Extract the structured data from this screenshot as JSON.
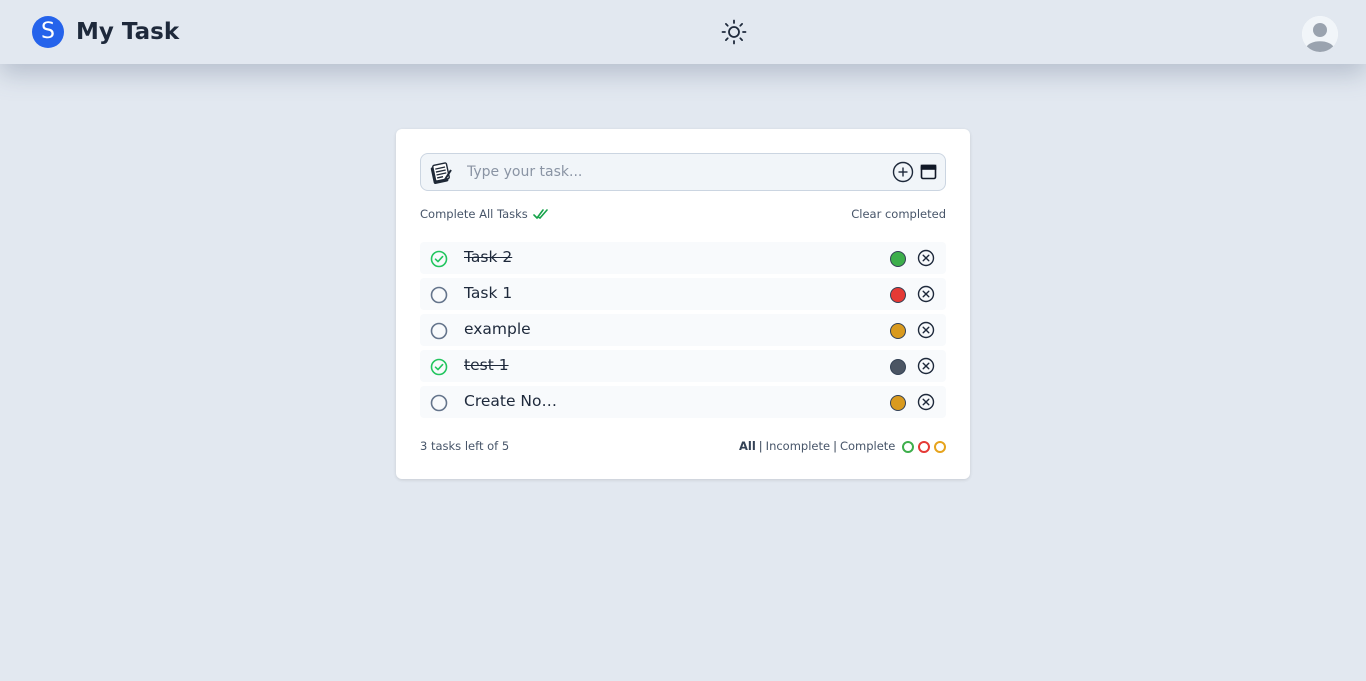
{
  "header": {
    "logo_letter": "S",
    "title": "My Task",
    "theme_icon": "sun-icon",
    "avatar_icon": "user-avatar-icon"
  },
  "input": {
    "placeholder": "Type your task...",
    "value": "",
    "icons": [
      "notepad-icon",
      "plus-circle-icon",
      "calendar-icon"
    ]
  },
  "actions": {
    "complete_all_label": "Complete All Tasks",
    "clear_completed_label": "Clear completed"
  },
  "tasks": [
    {
      "text": "Task 2",
      "completed": true,
      "priority_color": "#3dae4b"
    },
    {
      "text": "Task 1",
      "completed": false,
      "priority_color": "#e53935"
    },
    {
      "text": "example",
      "completed": false,
      "priority_color": "#d99a1e"
    },
    {
      "text": "test 1",
      "completed": true,
      "priority_color": "#4b5563"
    },
    {
      "text": "Create No…",
      "completed": false,
      "priority_color": "#d99a1e"
    }
  ],
  "footer": {
    "tasks_left": "3 tasks left of 5",
    "filters": {
      "all": "All",
      "incomplete": "Incomplete",
      "complete": "Complete",
      "separator": "|",
      "active": "All"
    },
    "priority_filters": [
      "#3dae4b",
      "#e53935",
      "#e6a31c"
    ]
  },
  "colors": {
    "background": "#e2e8f0",
    "brand": "#2563eb",
    "complete_check": "#22c55e"
  }
}
